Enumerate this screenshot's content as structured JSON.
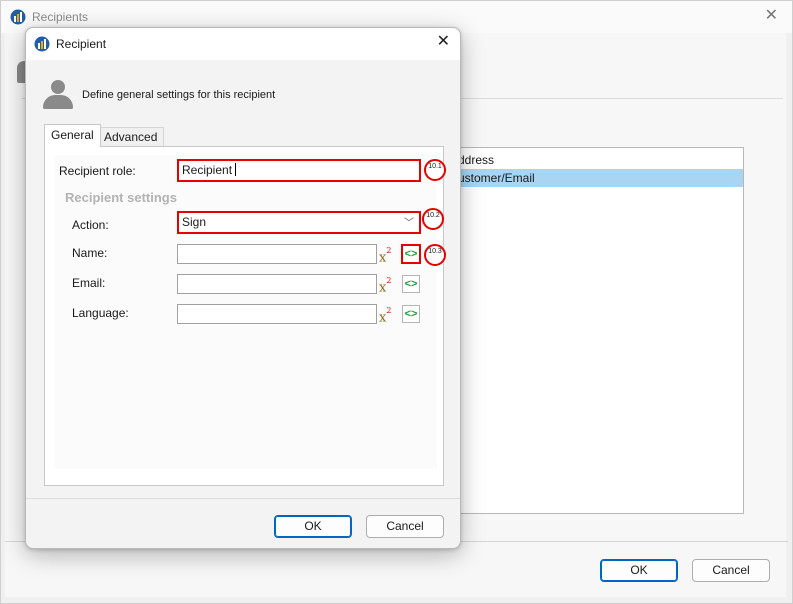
{
  "parent_window": {
    "title": "Recipients",
    "list_rows": [
      "ddress",
      "ustomer/Email"
    ],
    "ok_label": "OK",
    "cancel_label": "Cancel"
  },
  "dialog": {
    "title": "Recipient",
    "description": "Define general settings for this recipient",
    "tabs": [
      "General",
      "Advanced"
    ],
    "fields": {
      "role_label": "Recipient role:",
      "role_value": "Recipient",
      "group_title": "Recipient settings",
      "action_label": "Action:",
      "action_value": "Sign",
      "name_label": "Name:",
      "name_value": "",
      "email_label": "Email:",
      "email_value": "",
      "language_label": "Language:",
      "language_value": ""
    },
    "ok_label": "OK",
    "cancel_label": "Cancel"
  },
  "annotations": [
    "10.1",
    "10.2",
    "10.3"
  ],
  "colors": {
    "highlight": "#e60000",
    "selected_row": "#a8d6f2",
    "primary_button_border": "#0067c0"
  },
  "icons": [
    "app-logo-icon",
    "close-icon",
    "user-icon",
    "chevron-down-icon",
    "variable-x2-icon",
    "code-tag-icon"
  ]
}
